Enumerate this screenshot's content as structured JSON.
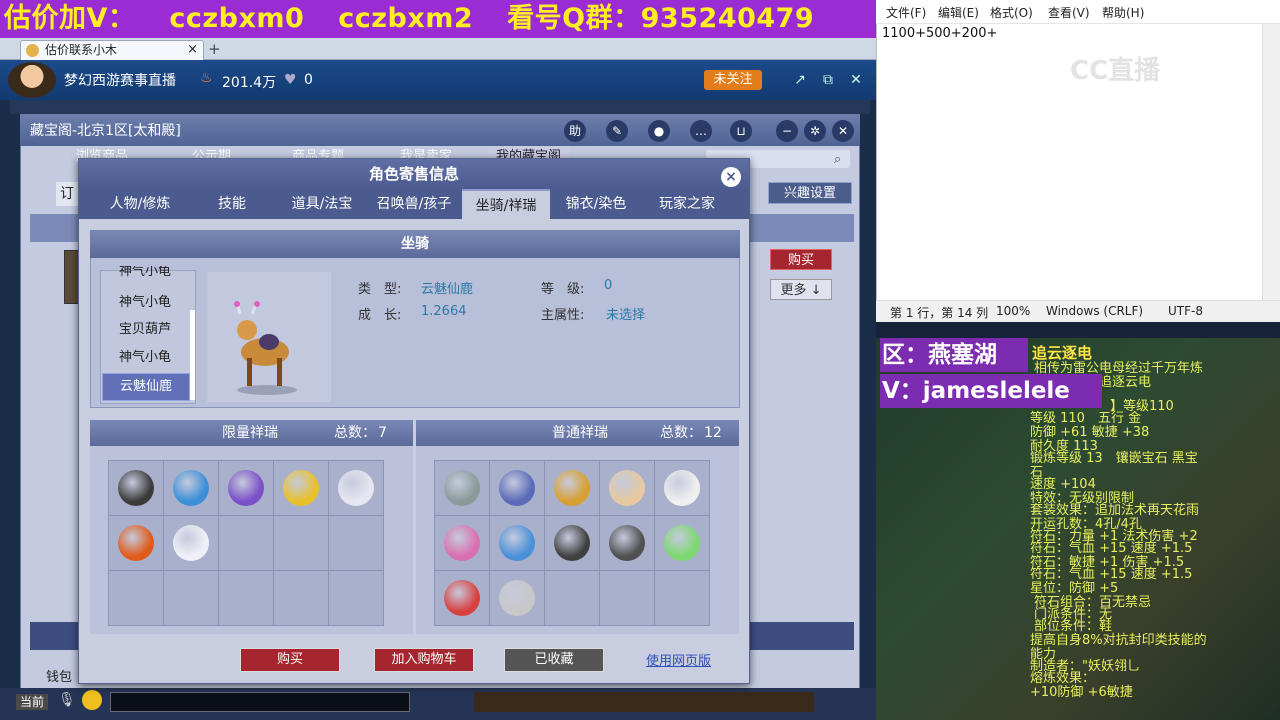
{
  "banner": {
    "part1": "估价加V：",
    "part2": "cczbxm0",
    "part3": "cczbxm2",
    "part4": "看号Q群：935240479"
  },
  "browser": {
    "tab_title": "估价联系小木"
  },
  "stream": {
    "title": "梦幻西游赛事直播",
    "popularity": "201.4万",
    "likes": "0",
    "follow_label": "未关注"
  },
  "cbg": {
    "window_title": "藏宝阁-北京1区[太和殿]",
    "nav": [
      "浏览商品",
      "公示期",
      "商品专题",
      "我是卖家",
      "我的藏宝阁"
    ],
    "interest_label": "兴趣设置",
    "order_fragment": "订",
    "buy_label": "购买",
    "more_label": "更多 ↓",
    "wallet_label": "钱包"
  },
  "dialog": {
    "title": "角色寄售信息",
    "tabs": [
      "人物/修炼",
      "技能",
      "道具/法宝",
      "召唤兽/孩子",
      "坐骑/祥瑞",
      "锦衣/染色",
      "玩家之家"
    ],
    "active_tab": "坐骑/祥瑞",
    "mount_header": "坐骑",
    "mounts": [
      "神气小龟",
      "神气小龟",
      "宝贝葫芦",
      "神气小龟",
      "云魅仙鹿"
    ],
    "selected_mount": "云魅仙鹿",
    "type_label": "类　型:",
    "type_value": "云魅仙鹿",
    "growth_label": "成　长:",
    "growth_value": "1.2664",
    "level_label": "等　级:",
    "level_value": "0",
    "attr_label": "主属性:",
    "attr_value": "未选择",
    "limited_header": "限量祥瑞",
    "limited_total_label": "总数：",
    "limited_total": "7",
    "normal_header": "普通祥瑞",
    "normal_total_label": "总数：",
    "normal_total": "12",
    "buttons": {
      "buy": "购买",
      "add_cart": "加入购物车",
      "favorited": "已收藏"
    },
    "web_link": "使用网页版"
  },
  "limited_pets": [
    "#3b3b3b",
    "#3b8fd8",
    "#7a4fc8",
    "#e8c02a",
    "#e6e6f0",
    "#e05a1a",
    "#f0f0f8"
  ],
  "normal_pets": [
    "#8a9a9a",
    "#5a6ab8",
    "#d8a030",
    "#e8c8a0",
    "#f0f0f0",
    "#d870b0",
    "#4a90d8",
    "#404040",
    "#505050",
    "#7cd870",
    "#d84040",
    "#c8c8c8"
  ],
  "notepad": {
    "menu": [
      "文件(F)",
      "编辑(E)",
      "格式(O)",
      "查看(V)",
      "帮助(H)"
    ],
    "text": "1100+500+200+",
    "watermark": "CC直播",
    "status_pos": "第 1 行，第 14 列",
    "status_zoom": "100%",
    "status_eol": "Windows (CRLF)",
    "status_enc": "UTF-8"
  },
  "equip": {
    "zone": "区：燕塞湖",
    "wechat": "V：jameslelele",
    "name": "追云逐电",
    "lines": [
      "相传为雷公电母经过千万年炼",
      "等上启可以追逐云电",
      "】等级110",
      "等级 110　五行 金",
      "防御 +61 敏捷 +38",
      "耐久度 113",
      "锻炼等级 13　镶嵌宝石 黑宝",
      "石",
      "速度 +104",
      "特效：无级别限制",
      "套装效果：追加法术再天花雨",
      "开运孔数：4孔/4孔",
      "符石：力量 +1 法术伤害 +2",
      "符石：气血 +15 速度 +1.5",
      "符石：敏捷 +1 伤害 +1.5",
      "符石：气血 +15 速度 +1.5",
      "星位：防御 +5",
      "符石组合：百无禁忌",
      "门派条件：无",
      "部位条件：鞋",
      "提高自身8%对抗封印类技能的",
      "能力",
      "制造者：\"妖妖翎乚",
      "熔炼效果：",
      "+10防御 +6敏捷"
    ]
  },
  "chat": {
    "current_label": "当前"
  }
}
